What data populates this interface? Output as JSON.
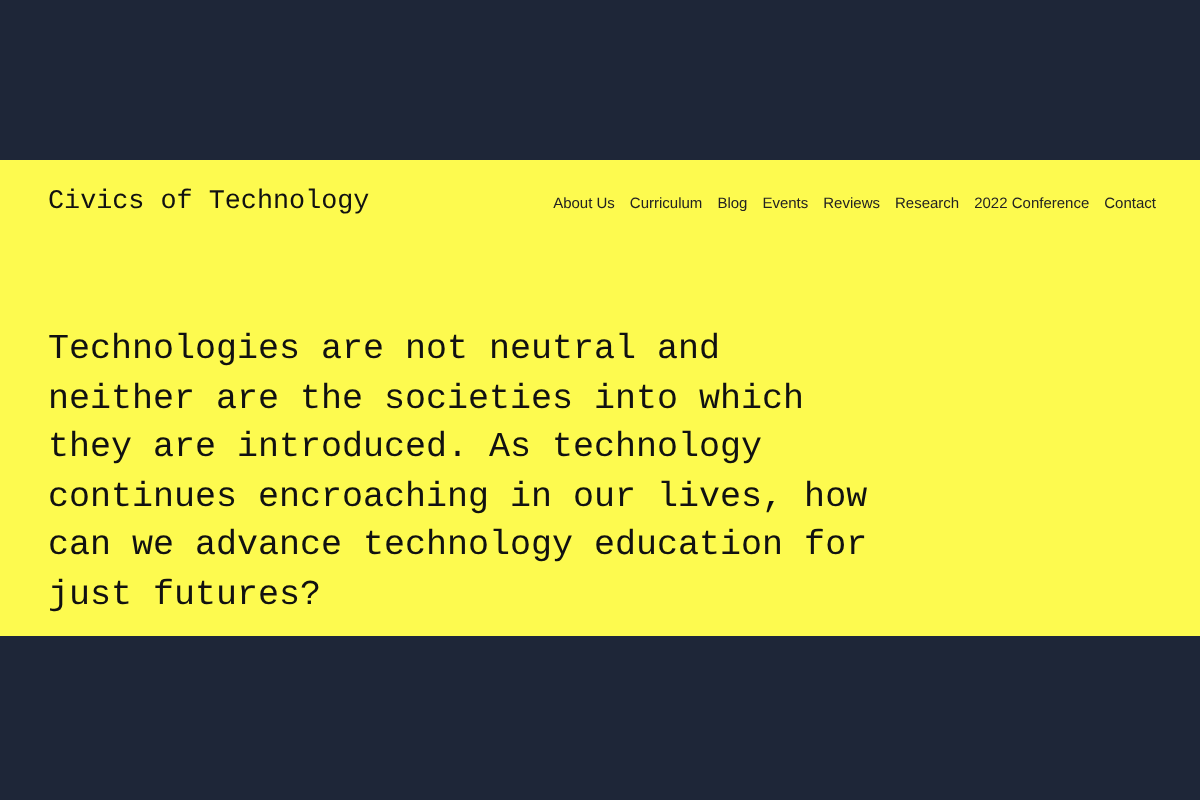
{
  "site_title": "Civics of Technology",
  "nav": [
    "About Us",
    "Curriculum",
    "Blog",
    "Events",
    "Reviews",
    "Research",
    "2022 Conference",
    "Contact"
  ],
  "hero_text": "Technologies are not neutral and neither are the societies into which they are introduced. As technology continues encroaching in our lives, how can we advance technology education for just futures?"
}
